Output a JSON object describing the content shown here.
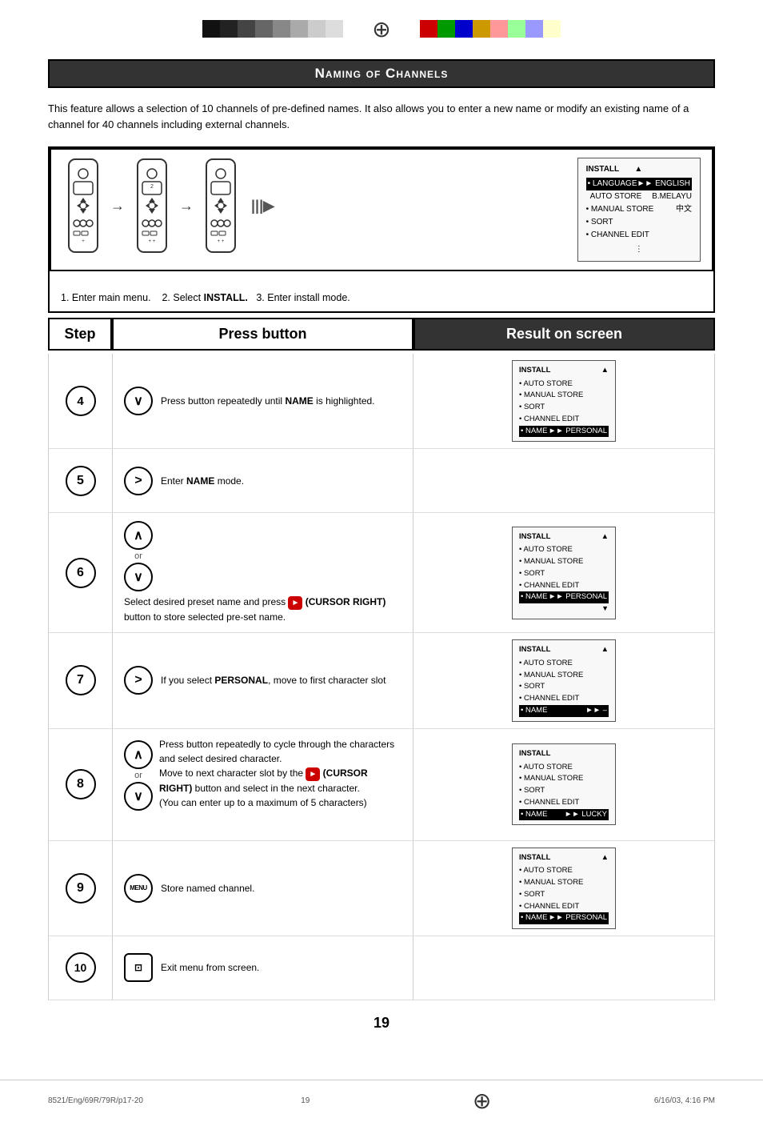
{
  "page": {
    "number": "19",
    "filename_left": "8521/Eng/69R/79R/p17-20",
    "filename_right": "6/16/03, 4:16 PM"
  },
  "title": "Naming of Channels",
  "intro": "This feature allows a selection of 10 channels of pre-defined names. It also allows you to enter a new name or modify an existing name of a channel for 40 channels including external channels.",
  "illustration": {
    "caption_1": "1. Enter main menu.",
    "caption_2": "2. Select",
    "caption_bold": "INSTALL.",
    "caption_3": "3. Enter install mode.",
    "menu": {
      "title": "INSTALL",
      "rows": [
        {
          "label": "• LANGUAGE",
          "value": "►► ENGLISH",
          "highlighted": true
        },
        {
          "label": "AUTO STORE",
          "value": "B.MELAYU",
          "highlighted": false
        },
        {
          "label": "• MANUAL STORE",
          "value": "中文",
          "highlighted": false
        },
        {
          "label": "• SORT",
          "value": "",
          "highlighted": false
        },
        {
          "label": "• CHANNEL EDIT",
          "value": "",
          "highlighted": false
        }
      ]
    }
  },
  "step_header": {
    "step": "Step",
    "press": "Press button",
    "result": "Result on screen"
  },
  "steps": [
    {
      "num": "4",
      "button": "down",
      "description": "Press button repeatedly until ",
      "bold_word": "NAME",
      "description_end": " is highlighted.",
      "result_menu": {
        "title": "INSTALL",
        "up_arrow": true,
        "rows": [
          {
            "label": "• AUTO STORE",
            "value": ""
          },
          {
            "label": "• MANUAL STORE",
            "value": ""
          },
          {
            "label": "• SORT",
            "value": ""
          },
          {
            "label": "• CHANNEL EDIT",
            "value": ""
          },
          {
            "label": "• NAME",
            "value": "►► PERSONAL",
            "hl": true
          }
        ]
      }
    },
    {
      "num": "5",
      "button": "right",
      "description": "Enter ",
      "bold_word": "NAME",
      "description_end": " mode.",
      "result_menu": null
    },
    {
      "num": "6",
      "button": "up_down",
      "has_cursor_right": true,
      "description": "Select desired preset name and press ",
      "cursor_label": "►",
      "cursor_bold": "(CURSOR RIGHT)",
      "description_end": " button to store selected pre-set name.",
      "result_menu": {
        "title": "INSTALL",
        "up_arrow": true,
        "rows": [
          {
            "label": "• AUTO STORE",
            "value": ""
          },
          {
            "label": "• MANUAL STORE",
            "value": ""
          },
          {
            "label": "• SORT",
            "value": ""
          },
          {
            "label": "• CHANNEL EDIT",
            "value": ""
          },
          {
            "label": "• NAME",
            "value": "►► PERSONAL",
            "hl": true
          }
        ]
      }
    },
    {
      "num": "7",
      "button": "right",
      "description": "If you select ",
      "bold_word": "PERSONAL",
      "description_end": ", move to first character slot",
      "result_menu": {
        "title": "INSTALL",
        "up_arrow": true,
        "rows": [
          {
            "label": "• AUTO STORE",
            "value": ""
          },
          {
            "label": "• MANUAL STORE",
            "value": ""
          },
          {
            "label": "• SORT",
            "value": ""
          },
          {
            "label": "• CHANNEL EDIT",
            "value": ""
          },
          {
            "label": "• NAME",
            "value": "►► –",
            "hl": true
          }
        ]
      }
    },
    {
      "num": "8",
      "button": "up_down",
      "has_cursor_right": true,
      "description_lines": [
        "Press button repeatedly to cycle through the characters and select desired character.",
        "Move to next character slot by the ► (CURSOR RIGHT) button and select in the next character.",
        "(You can enter up to a maximum of 5 characters)"
      ],
      "result_menu": {
        "title": "INSTALL",
        "up_arrow": false,
        "rows": [
          {
            "label": "• AUTO STORE",
            "value": ""
          },
          {
            "label": "• MANUAL STORE",
            "value": ""
          },
          {
            "label": "• SORT",
            "value": ""
          },
          {
            "label": "• CHANNEL EDIT",
            "value": ""
          },
          {
            "label": "• NAME",
            "value": "►► LUCKY",
            "hl": true
          }
        ]
      }
    },
    {
      "num": "9",
      "button": "menu",
      "description": "Store named channel.",
      "result_menu": {
        "title": "INSTALL",
        "up_arrow": true,
        "rows": [
          {
            "label": "• AUTO STORE",
            "value": ""
          },
          {
            "label": "• MANUAL STORE",
            "value": ""
          },
          {
            "label": "• SORT",
            "value": ""
          },
          {
            "label": "• CHANNEL EDIT",
            "value": ""
          },
          {
            "label": "• NAME",
            "value": "►► PERSONAL",
            "hl": true
          }
        ]
      }
    },
    {
      "num": "10",
      "button": "exit",
      "description": "Exit menu from screen.",
      "result_menu": null
    }
  ],
  "colors": {
    "strip_left": [
      "#111",
      "#333",
      "#555",
      "#777",
      "#999",
      "#bbb",
      "#ddd",
      "#eee"
    ],
    "strip_right_dark": [
      "#cc0000",
      "#009900",
      "#0000cc",
      "#cc9900"
    ],
    "strip_right_light": [
      "#ff9999",
      "#99ff99",
      "#9999ff",
      "#ffff99",
      "#ffcccc",
      "#ccffcc"
    ],
    "header_bg": "#333333",
    "result_header_bg": "#333333"
  }
}
